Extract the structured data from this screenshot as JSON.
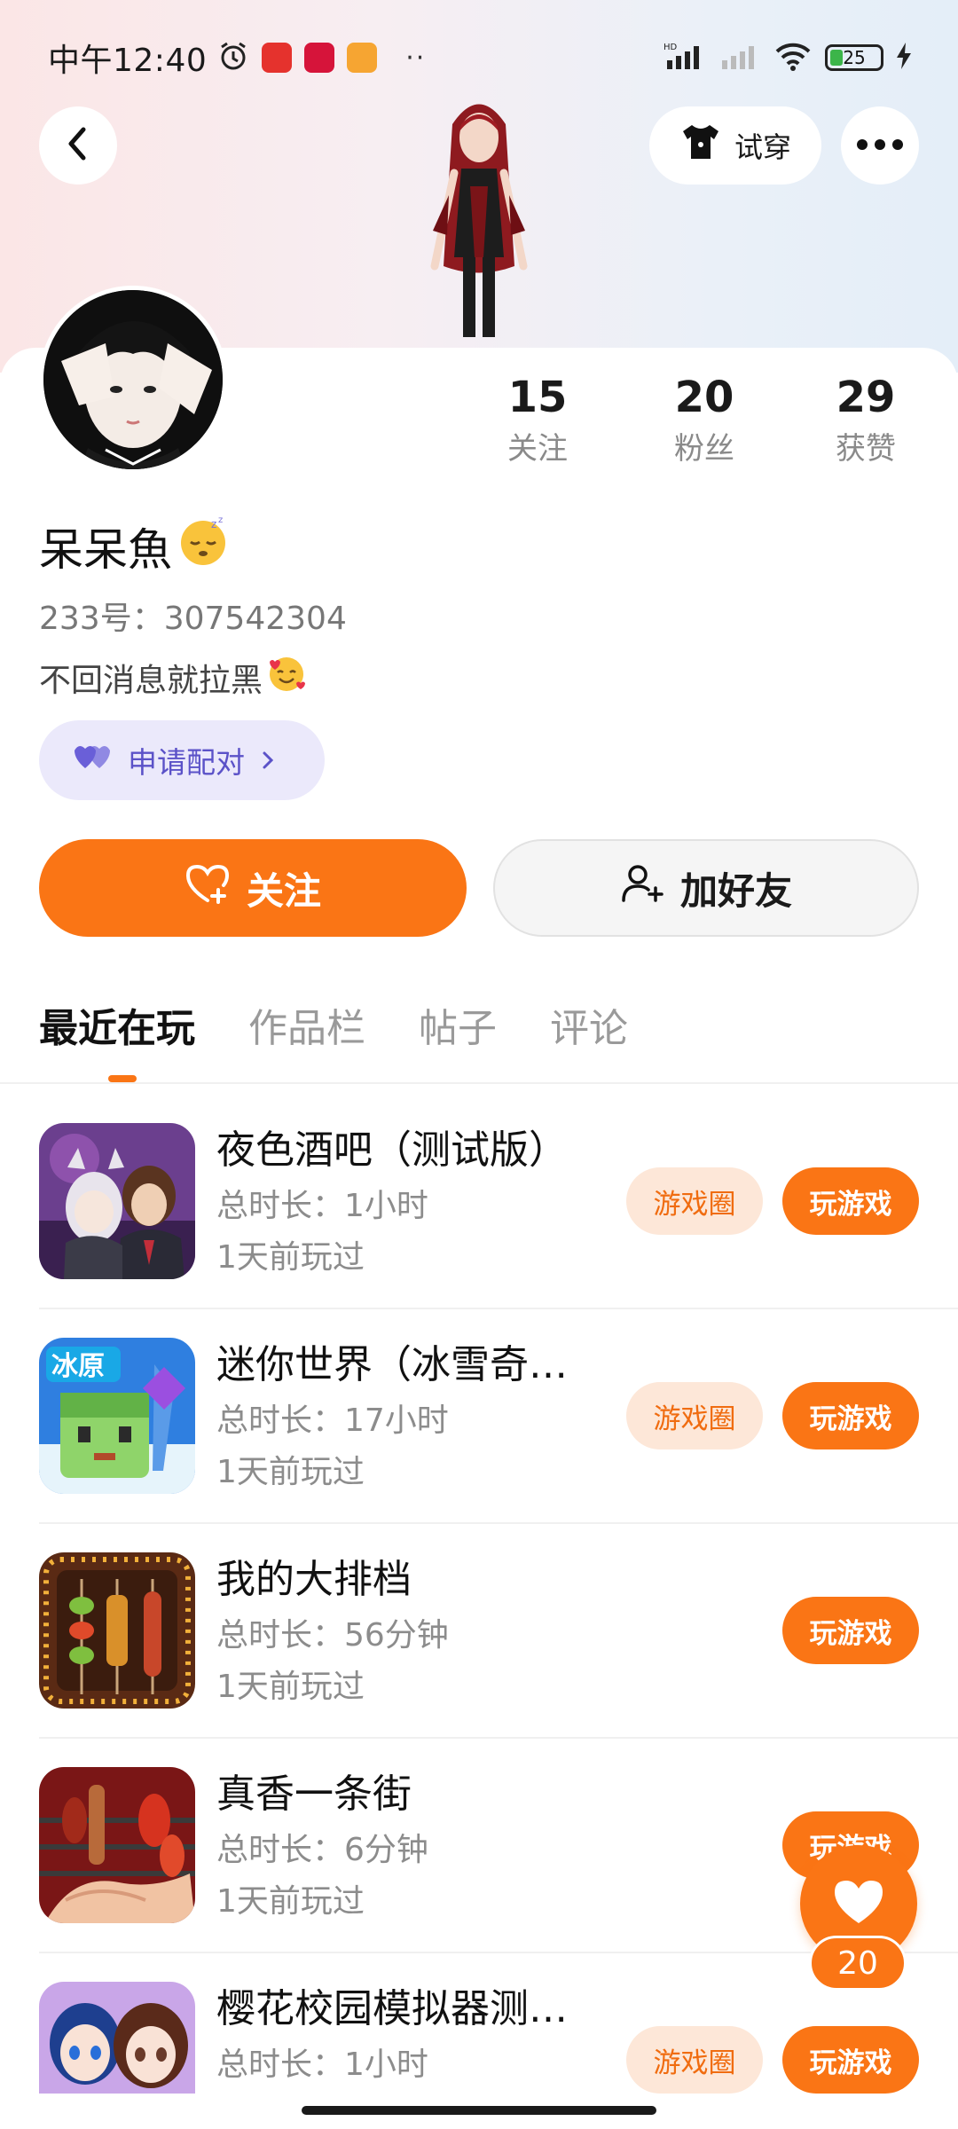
{
  "status_bar": {
    "time": "中午12:40",
    "battery": "25",
    "network_label": "HD"
  },
  "header": {
    "try_on_label": "试穿"
  },
  "profile": {
    "stats": [
      {
        "value": "15",
        "label": "关注"
      },
      {
        "value": "20",
        "label": "粉丝"
      },
      {
        "value": "29",
        "label": "获赞"
      }
    ],
    "nickname": "呆呆魚",
    "uid": "233号：307542304",
    "bio": "不回消息就拉黑",
    "pair_label": "申请配对"
  },
  "actions": {
    "follow_label": "关注",
    "add_friend_label": "加好友"
  },
  "tabs": [
    {
      "label": "最近在玩",
      "active": true
    },
    {
      "label": "作品栏",
      "active": false
    },
    {
      "label": "帖子",
      "active": false
    },
    {
      "label": "评论",
      "active": false
    }
  ],
  "games": [
    {
      "title": "夜色酒吧（测试版）",
      "duration": "总时长：1小时",
      "last_played": "1天前玩过",
      "circle_label": "游戏圈",
      "play_label": "玩游戏",
      "has_circle": true
    },
    {
      "title": "迷你世界（冰雪奇…",
      "duration": "总时长：17小时",
      "last_played": "1天前玩过",
      "circle_label": "游戏圈",
      "play_label": "玩游戏",
      "has_circle": true,
      "icon_text": "冰原"
    },
    {
      "title": "我的大排档",
      "duration": "总时长：56分钟",
      "last_played": "1天前玩过",
      "play_label": "玩游戏",
      "has_circle": false
    },
    {
      "title": "真香一条街",
      "duration": "总时长：6分钟",
      "last_played": "1天前玩过",
      "play_label": "玩游戏",
      "has_circle": false
    },
    {
      "title": "樱花校园模拟器测…",
      "duration": "总时长：1小时",
      "circle_label": "游戏圈",
      "play_label": "玩游戏",
      "has_circle": true
    }
  ],
  "like_fab": {
    "count": "20"
  },
  "colors": {
    "accent": "#fa7515",
    "pair_bg": "#ebe9fb",
    "pair_text": "#5b52c8",
    "circle_bg": "#fde7d8"
  }
}
